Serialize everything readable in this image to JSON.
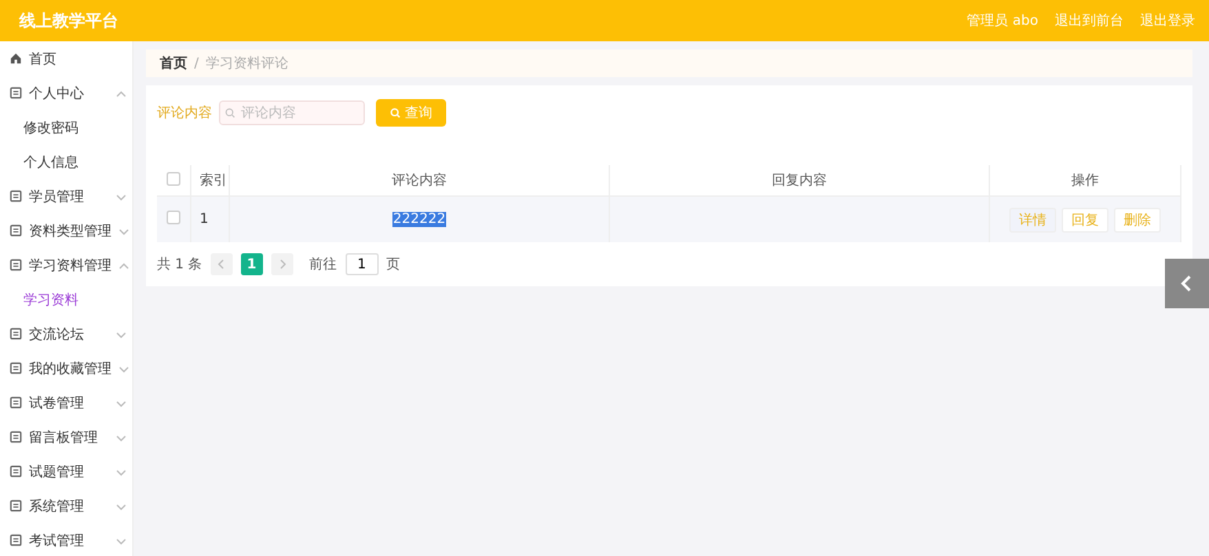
{
  "header": {
    "title": "线上教学平台",
    "links": [
      "管理员 abo",
      "退出到前台",
      "退出登录"
    ]
  },
  "sidebar": {
    "items": [
      {
        "label": "首页"
      },
      {
        "label": "个人中心",
        "expanded": true,
        "children": [
          {
            "label": "修改密码",
            "selected": false
          },
          {
            "label": "个人信息",
            "selected": false
          }
        ]
      },
      {
        "label": "学员管理",
        "expanded": false
      },
      {
        "label": "资料类型管理",
        "expanded": false
      },
      {
        "label": "学习资料管理",
        "expanded": true,
        "children": [
          {
            "label": "学习资料",
            "selected": true
          }
        ]
      },
      {
        "label": "交流论坛",
        "expanded": false
      },
      {
        "label": "我的收藏管理",
        "expanded": false
      },
      {
        "label": "试卷管理",
        "expanded": false
      },
      {
        "label": "留言板管理",
        "expanded": false
      },
      {
        "label": "试题管理",
        "expanded": false
      },
      {
        "label": "系统管理",
        "expanded": false
      },
      {
        "label": "考试管理",
        "expanded": false
      }
    ]
  },
  "breadcrumb": [
    "首页",
    "/",
    "学习资料评论"
  ],
  "search": {
    "label": "评论内容",
    "placeholder": "评论内容",
    "button": "查询"
  },
  "table": {
    "select_all_checked": false,
    "columns": [
      "索引",
      "评论内容",
      "回复内容",
      "操作"
    ],
    "rows": [
      {
        "checked": false,
        "index": "1",
        "comment": "222222",
        "comment_highlighted": true,
        "actions": [
          "详情",
          "回复",
          "删除"
        ]
      }
    ]
  },
  "pagination": {
    "total": "共 1 条",
    "pages": [
      {
        "label": "1",
        "selected": true
      }
    ],
    "goto_label": "前往",
    "goto_value": "1",
    "goto_unit": "页"
  }
}
